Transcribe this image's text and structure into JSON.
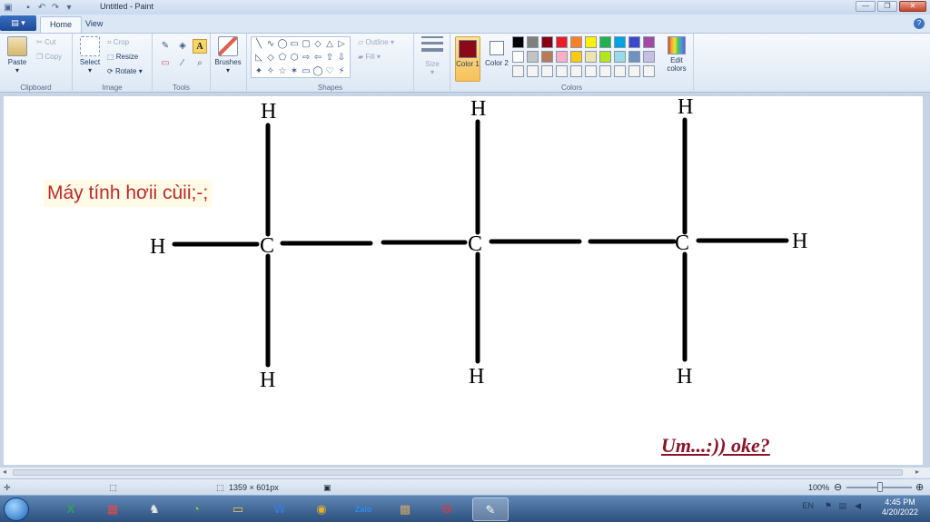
{
  "window": {
    "title": "Untitled - Paint",
    "minimize": "—",
    "maximize": "❐",
    "close": "✕"
  },
  "quick_access": {
    "paint_icon": "paint-icon",
    "save_icon": "save-icon",
    "undo_icon": "undo-icon",
    "redo_icon": "redo-icon",
    "customize_icon": "dropdown-icon"
  },
  "tabs": {
    "file": "▤ ▾",
    "home": "Home",
    "view": "View",
    "help": "?"
  },
  "ribbon": {
    "clipboard": {
      "label": "Clipboard",
      "paste": "Paste",
      "cut": "Cut",
      "copy": "Copy"
    },
    "image": {
      "label": "Image",
      "select": "Select",
      "crop": "Crop",
      "resize": "Resize",
      "rotate": "Rotate"
    },
    "tools": {
      "label": "Tools",
      "pencil": "✎",
      "fill": "◈",
      "text": "A",
      "eraser": "▭",
      "picker": "⁄",
      "magnifier": "⌕"
    },
    "brushes": {
      "label": "Brushes"
    },
    "shapes": {
      "label": "Shapes",
      "outline": "Outline",
      "fill": "Fill",
      "items": [
        "╲",
        "∿",
        "◯",
        "▭",
        "▢",
        "◇",
        "△",
        "▷",
        "◺",
        "◇",
        "⬠",
        "⬡",
        "⇨",
        "⇦",
        "⇧",
        "⇩",
        "✦",
        "✧",
        "☆",
        "✶",
        "▭",
        "◯",
        "♡",
        "⚡"
      ]
    },
    "size": {
      "label": "Size"
    },
    "colors": {
      "label": "Colors",
      "color1": "Color 1",
      "color2": "Color 2",
      "color1_value": "#8b0a17",
      "color2_value": "#ffffff",
      "edit": "Edit colors",
      "palette": [
        "#000000",
        "#7f7f7f",
        "#880015",
        "#ed1c24",
        "#ff7f27",
        "#fff200",
        "#22b14c",
        "#00a2e8",
        "#3f48cc",
        "#a349a4",
        "#ffffff",
        "#c3c3c3",
        "#b97a57",
        "#ffaec9",
        "#ffc90e",
        "#efe4b0",
        "#b5e61d",
        "#99d9ea",
        "#7092be",
        "#c8bfe7",
        "#f4f4f4",
        "#f4f4f4",
        "#f4f4f4",
        "#f4f4f4",
        "#f4f4f4",
        "#f4f4f4",
        "#f4f4f4",
        "#f4f4f4",
        "#f4f4f4",
        "#f4f4f4"
      ]
    }
  },
  "canvas": {
    "note": "Máy tính hơii cùii;-;",
    "signature": "Um...:)) oke?",
    "atoms": [
      "H",
      "H",
      "H",
      "H",
      "C",
      "H",
      "C",
      "H",
      "H",
      "C",
      "H",
      "H"
    ]
  },
  "status": {
    "canvas_size": "1359 × 601px",
    "zoom": "100%"
  },
  "taskbar": {
    "apps": [
      "X",
      "▦",
      "♞",
      "◔",
      "▭",
      "W",
      "◉",
      "Zalo",
      "▩",
      "O",
      "✎"
    ],
    "language": "EN",
    "time": "4:45 PM",
    "date": "4/20/2022"
  }
}
